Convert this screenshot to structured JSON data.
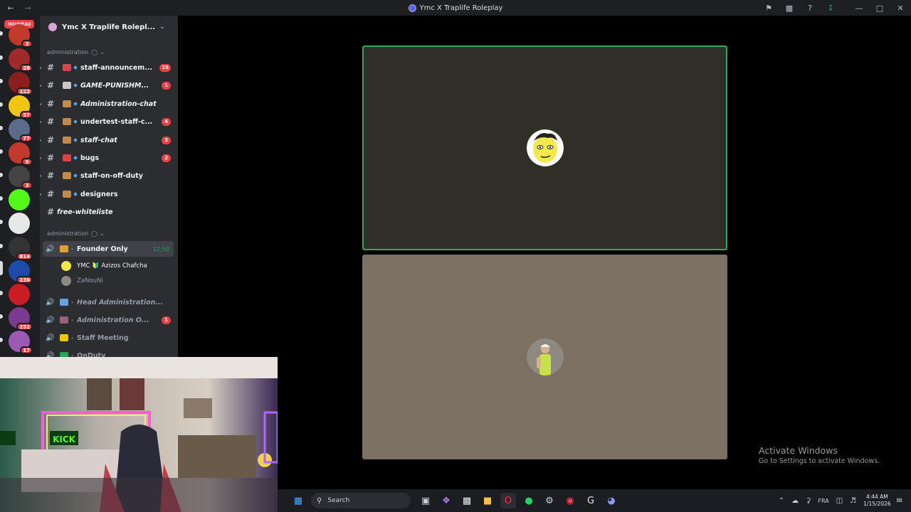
{
  "window": {
    "title": "Ymc X Traplife Roleplay"
  },
  "rail": {
    "new_label": "NOUVEAU",
    "servers": [
      {
        "badge": "3",
        "color": "#c0392b"
      },
      {
        "badge": "28",
        "color": "#a02a2a"
      },
      {
        "badge": "122",
        "color": "#8b1e1e"
      },
      {
        "badge": "57",
        "color": "#f2c511"
      },
      {
        "badge": "77",
        "color": "#5b6b8a"
      },
      {
        "badge": "9",
        "color": "#c0392b"
      },
      {
        "badge": "3",
        "color": "#444444"
      },
      {
        "badge": "",
        "color": "#53fc18"
      },
      {
        "badge": "",
        "color": "#e8e8e8"
      },
      {
        "badge": "814",
        "color": "#333333"
      },
      {
        "badge": "236",
        "color": "#1f4aa8"
      },
      {
        "badge": "",
        "color": "#c81d25"
      },
      {
        "badge": "252",
        "color": "#7a3b8f"
      },
      {
        "badge": "17",
        "color": "#9b59b6"
      }
    ]
  },
  "server": {
    "name": "Ymc X Traplife Rolepl..."
  },
  "categories": [
    {
      "label": "administration"
    },
    {
      "label": "administration"
    }
  ],
  "text_channels": [
    {
      "name": "staff-announcem...",
      "count": "19",
      "italic": false,
      "emoji_color": "#d9454c"
    },
    {
      "name": "GAME-PUNISHM...",
      "count": "1",
      "italic": true,
      "emoji_color": "#c8c8c8"
    },
    {
      "name": "Administration-chat",
      "count": "",
      "italic": true,
      "emoji_color": "#c08a4a"
    },
    {
      "name": "undertest-staff-c...",
      "count": "4",
      "italic": false,
      "emoji_color": "#c08a4a"
    },
    {
      "name": "staff-chat",
      "count": "3",
      "italic": true,
      "emoji_color": "#c08a4a"
    },
    {
      "name": "bugs",
      "count": "2",
      "italic": false,
      "emoji_color": "#e04040"
    },
    {
      "name": "staff-on-off-duty",
      "count": "",
      "italic": false,
      "emoji_color": "#c08a4a"
    },
    {
      "name": "designers",
      "count": "",
      "italic": false,
      "emoji_color": "#c08a4a"
    },
    {
      "name": "free-whiteliste",
      "count": "",
      "italic": true,
      "emoji_color": ""
    }
  ],
  "voice_channels": [
    {
      "name": "Founder Only",
      "timer": "12:50",
      "count": ""
    },
    {
      "name": "Head Administration...",
      "timer": "",
      "count": ""
    },
    {
      "name": "Administration O...",
      "timer": "",
      "count": "1"
    },
    {
      "name": "Staff Meeting",
      "timer": "",
      "count": ""
    },
    {
      "name": "OnDuty",
      "timer": "",
      "count": ""
    }
  ],
  "voice_users": [
    {
      "name": "YMC 🔰 Azizos Chafcha"
    },
    {
      "name": "ZaNouNi"
    }
  ],
  "watermark": {
    "line1": "Activate Windows",
    "line2": "Go to Settings to activate Windows."
  },
  "taskbar": {
    "search_placeholder": "Search",
    "lang": "FRA",
    "time": "4:44 AM",
    "date": "1/15/2026"
  }
}
